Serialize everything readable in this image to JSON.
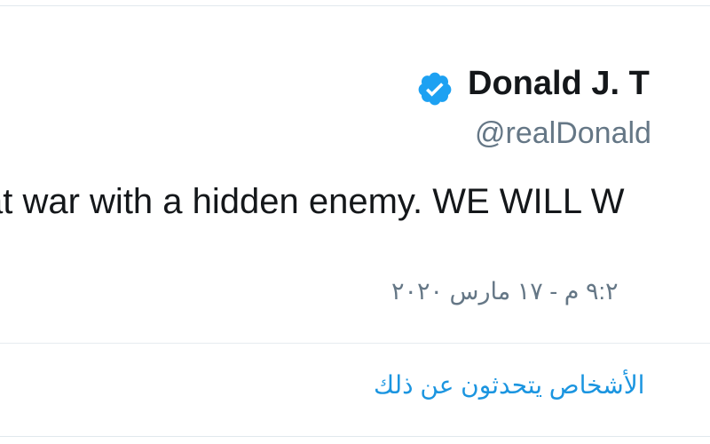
{
  "tweet": {
    "author": {
      "display_name": "Donald J. T",
      "handle": "@realDonald"
    },
    "text": "at war with a hidden enemy. WE WILL W",
    "timestamp": "٩:٢ م - ١٧ مارس ٢٠٢٠",
    "people_link": "الأشخاص يتحدثون عن ذلك"
  },
  "icons": {
    "verified": "verified-badge-icon"
  },
  "colors": {
    "text": "#14171a",
    "secondary": "#657786",
    "link": "#1b95e0",
    "verified": "#1da1f2",
    "border": "#e1e8ed"
  }
}
